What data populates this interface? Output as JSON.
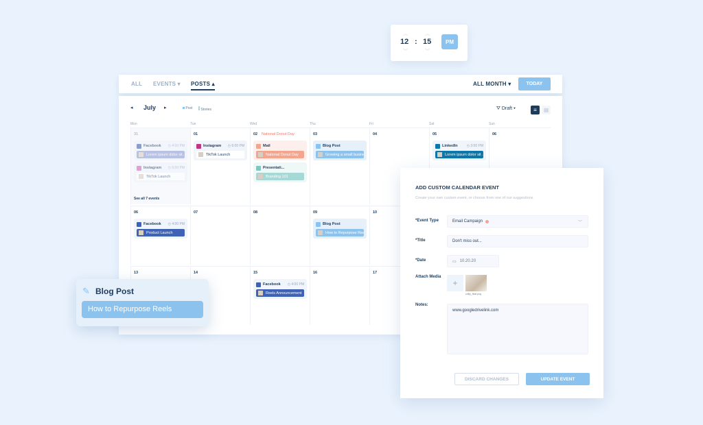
{
  "time_picker": {
    "hour": "12",
    "minute": "15",
    "separator": ":",
    "period": "PM"
  },
  "tabs": [
    {
      "label": "ALL"
    },
    {
      "label": "EVENTS",
      "caret": "▾"
    },
    {
      "label": "POSTS",
      "caret": "▴",
      "active": true
    }
  ],
  "range": {
    "label": "ALL MONTH",
    "caret": "▾"
  },
  "today_label": "TODAY",
  "calendar": {
    "month": "July",
    "prev": "◂",
    "next": "▸",
    "legend": [
      {
        "label": "Post",
        "color": "#8cc3ee"
      },
      {
        "label": "Stories",
        "color": "#a6d9d6"
      }
    ],
    "filter": {
      "label": "Draft",
      "icon": "filter-icon"
    },
    "day_names": [
      "Mon",
      "Tue",
      "Wed",
      "Thu",
      "Fri",
      "Sat",
      "Sun"
    ],
    "see_all": "See all 7 events",
    "weeks": [
      [
        {
          "num": "31",
          "muted": true,
          "events": [
            {
              "platform": "Facebook",
              "time": "4:00 PM",
              "text": "Lorem ipsum dolor sit ...",
              "bar": "#8e9fd6",
              "icon": "#3f62b5",
              "bg": "#eff3fb"
            },
            {
              "platform": "Instagram",
              "time": "6:00 PM",
              "text": "TikTok Launch",
              "bar": "#ffffff",
              "icon": "#c76bb5",
              "bg": "#eff3fb"
            }
          ]
        },
        {
          "num": "01",
          "events": [
            {
              "platform": "Instagram",
              "time": "6:00 PM",
              "text": "TikTok Launch",
              "bar": "#ffffff",
              "icon": "#c13584",
              "bg": "#f0f5fc"
            }
          ]
        },
        {
          "num": "02",
          "holiday": "National Donut Day",
          "events": [
            {
              "platform": "Mail",
              "text": "National Donut Day",
              "bar": "#f4a58e",
              "icon": "#f4a58e",
              "bg": "#fdf0ec"
            },
            {
              "platform": "Presentati...",
              "text": "Branding 101",
              "bar": "#a6d9d6",
              "icon": "#7cc8c2",
              "bg": "#eef8f6"
            }
          ]
        },
        {
          "num": "03",
          "events": [
            {
              "platform": "Blog Post",
              "text": "Growing a small business",
              "bar": "#8cc3ee",
              "icon": "#8cc3ee",
              "bg": "#e6f0fb"
            }
          ]
        },
        {
          "num": "04",
          "events": []
        },
        {
          "num": "05",
          "events": [
            {
              "platform": "LinkedIn",
              "time": "3:00 PM",
              "text": "Lorem ipsum dolor sit ...",
              "bar": "#0d77a8",
              "icon": "#0d77a8",
              "bg": "#f0f5fc"
            }
          ]
        },
        {
          "num": "06",
          "events": []
        }
      ],
      [
        {
          "num": "06",
          "events": [
            {
              "platform": "Facebook",
              "time": "4:00 PM",
              "text": "Product Launch",
              "bar": "#3f62b5",
              "icon": "#3f62b5",
              "bg": "#f0f5fc"
            }
          ]
        },
        {
          "num": "07",
          "events": []
        },
        {
          "num": "08",
          "events": []
        },
        {
          "num": "09",
          "events": [
            {
              "platform": "Blog Post",
              "text": "How to Repurpose Reels",
              "bar": "#8cc3ee",
              "icon": "#8cc3ee",
              "bg": "#e6f0fb"
            }
          ]
        },
        {
          "num": "10",
          "events": []
        }
      ],
      [
        {
          "num": "13",
          "events": []
        },
        {
          "num": "14",
          "events": []
        },
        {
          "num": "15",
          "events": [
            {
              "platform": "Facebook",
              "time": "4:00 PM",
              "text": "Reels Announcement",
              "bar": "#3f62b5",
              "icon": "#3f62b5",
              "bg": "#f0f5fc"
            }
          ]
        },
        {
          "num": "16",
          "events": []
        },
        {
          "num": "17",
          "events": []
        }
      ]
    ]
  },
  "modal": {
    "title": "ADD CUSTOM CALENDAR EVENT",
    "subtitle": "Create your own custom event, or choose from one of our suggestions",
    "event_type_label": "*Event Type",
    "event_type_value": "Email Campaign",
    "event_type_dot": "#f4a58e",
    "title_label": "*Title",
    "title_value": "Don't miss out...",
    "date_label": "*Date",
    "date_value": "10.20.20",
    "media_label": "Attach Media",
    "media_add": "+",
    "media_file": "chilly_final.png",
    "notes_label": "Notes:",
    "notes_value": "www.googledrivelink.com",
    "discard": "DISCARD CHANGES",
    "update": "UPDATE EVENT"
  },
  "popup": {
    "type": "Blog Post",
    "title": "How to Repurpose Reels"
  },
  "colors": {
    "accent": "#8cc3ee",
    "navy": "#1d3c5c"
  }
}
